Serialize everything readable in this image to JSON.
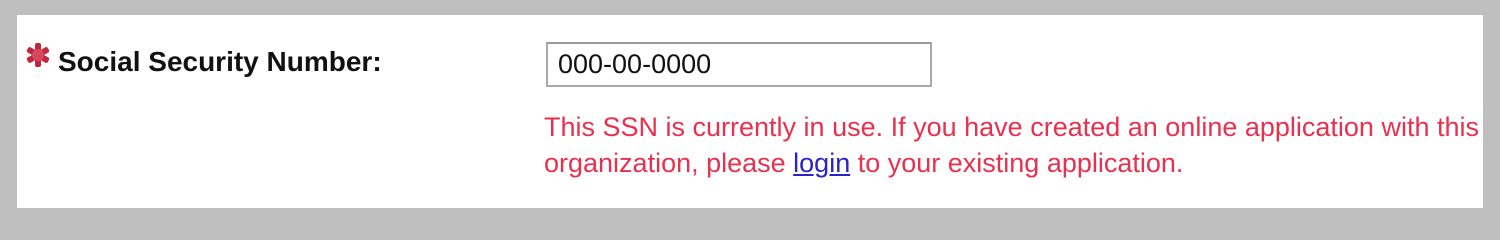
{
  "field": {
    "label": "Social Security Number:",
    "required_icon": "required-asterisk-icon",
    "value": "000-00-0000"
  },
  "error": {
    "text_before_link": "This SSN is currently in use. If you have created an online application with this organization, please ",
    "link_text": "login",
    "text_after_link": " to your existing application."
  },
  "colors": {
    "background_frame": "#bfbfbf",
    "panel": "#ffffff",
    "error_text": "#e8304f",
    "link": "#2b22c8",
    "required_icon": "#c0283e"
  }
}
